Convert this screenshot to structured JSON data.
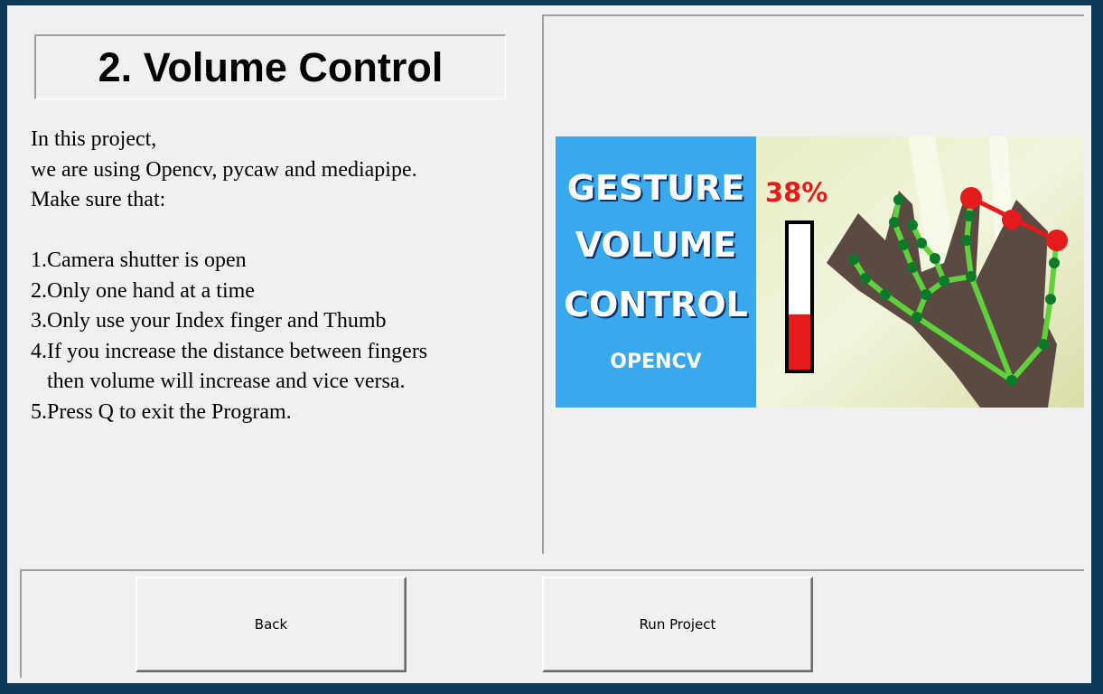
{
  "title": "2. Volume Control",
  "description": [
    "In this project,",
    "we are using Opencv, pycaw and mediapipe.",
    "Make sure that:",
    "",
    "1.Camera shutter is open",
    "2.Only one hand at a time",
    "3.Only use your Index finger and Thumb",
    "4.If you increase the distance between fingers",
    "   then volume will increase and vice versa.",
    "5.Press Q to exit the Program."
  ],
  "thumbnail": {
    "line1": "GESTURE",
    "line2": "VOLUME",
    "line3": "CONTROL",
    "line4": "OPENCV",
    "percent": "38%",
    "volume_level": 0.38
  },
  "buttons": {
    "back": "Back",
    "run": "Run Project"
  },
  "colors": {
    "frame": "#0f3a57",
    "window_bg": "#f0f0f0",
    "thumb_blue": "#3aa8ec",
    "percent_red": "#e41b1b",
    "hand_green": "#5fd13b"
  }
}
